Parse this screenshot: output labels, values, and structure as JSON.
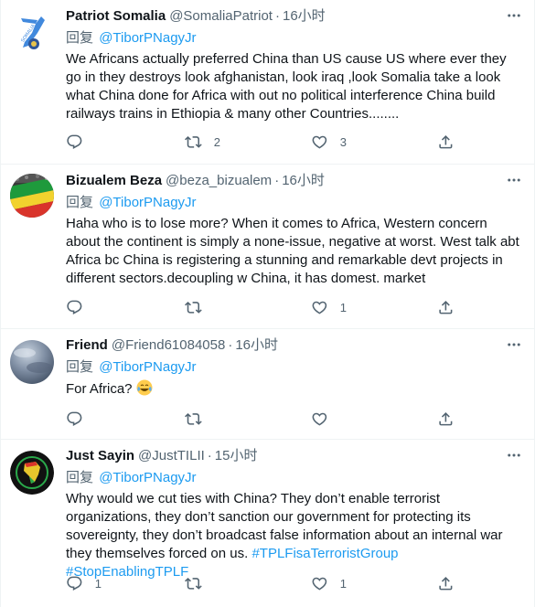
{
  "reply_prefix": "回复",
  "tweets": [
    {
      "name": "Patriot Somalia",
      "handle": "@SomaliaPatriot",
      "time": "16小时",
      "mention": "@TiborPNagyJr",
      "text": "We Africans actually preferred China than US cause US where ever they go in they destroys look afghanistan, look iraq ,look Somalia take a look what China done for Africa with out no political interference China build railways trains in Ethiopia & many other Countries........",
      "replies": "",
      "retweets": "2",
      "likes": "3",
      "avatar_icon": "somalia-flag-map-avatar"
    },
    {
      "name": "Bizualem Beza",
      "handle": "@beza_bizualem",
      "time": "16小时",
      "mention": "@TiborPNagyJr",
      "text": "Haha who is to lose more? When it comes to Africa, Western concern about the continent is simply a none-issue, negative at worst.  West talk abt Africa bc China is registering a stunning and remarkable devt projects in different sectors.decoupling w China, it has domest. market",
      "replies": "",
      "retweets": "",
      "likes": "1",
      "avatar_icon": "ethiopian-flag-crowd-avatar"
    },
    {
      "name": "Friend",
      "handle": "@Friend61084058",
      "time": "16小时",
      "mention": "@TiborPNagyJr",
      "text": "For Africa?",
      "text_emoji": "face-with-tears-of-joy-emoji",
      "replies": "",
      "retweets": "",
      "likes": "",
      "avatar_icon": "cloudy-sky-avatar"
    },
    {
      "name": "Just Sayin",
      "handle": "@JustTILII",
      "time": "15小时",
      "mention": "@TiborPNagyJr",
      "text": "Why would we cut ties with China? They don’t enable terrorist organizations, they don’t sanction our government for protecting its sovereignty, they don’t broadcast false information about an internal war they themselves forced on us.",
      "hashtags": [
        "#TPLFisaTerroristGroup",
        "#StopEnablingTPLF"
      ],
      "replies": "1",
      "retweets": "",
      "likes": "1",
      "avatar_icon": "africa-map-logo-avatar"
    }
  ],
  "colors": {
    "primary_text": "#0f1419",
    "secondary_text": "#536471",
    "link": "#1d9bf0",
    "divider": "#eff3f4"
  }
}
